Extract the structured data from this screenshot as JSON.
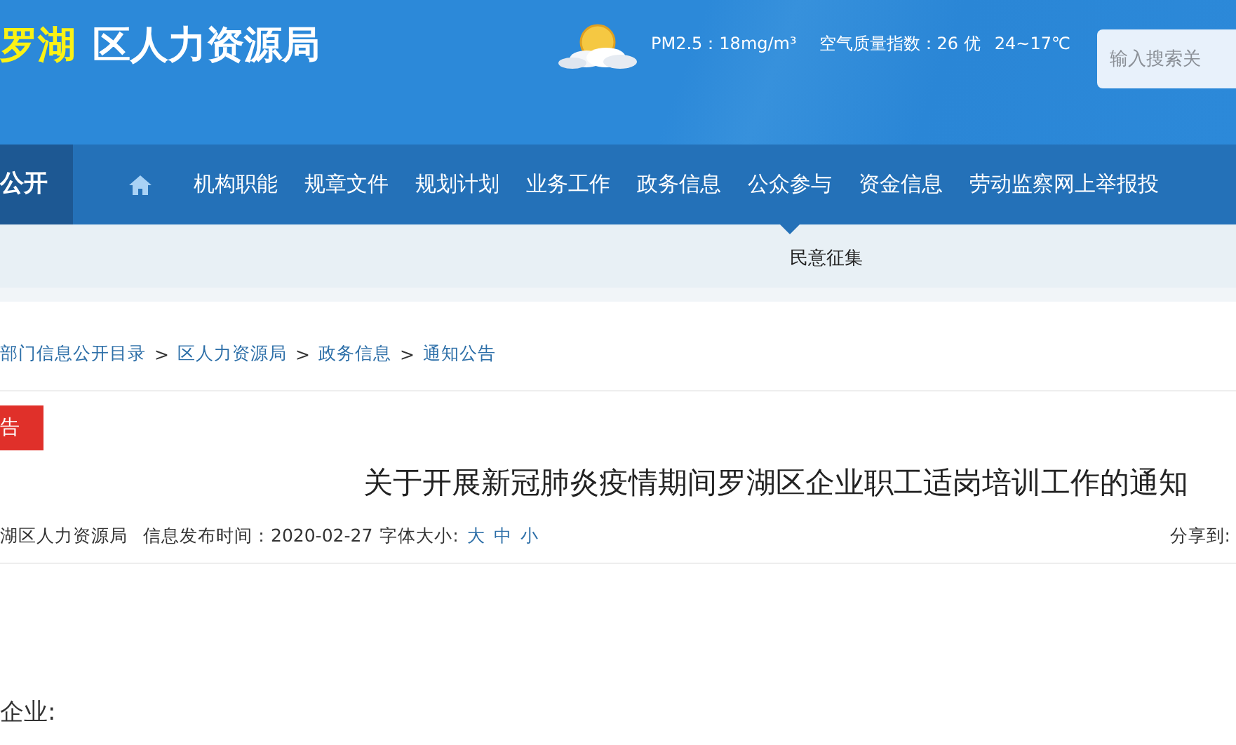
{
  "header": {
    "logo_highlight": "罗湖",
    "logo_text": "区人力资源局",
    "weather": {
      "pm25": "PM2.5：18mg/m³",
      "aqi": "空气质量指数：26 优",
      "temperature": "24~17℃"
    },
    "search": {
      "placeholder": "输入搜索关"
    }
  },
  "nav": {
    "section_label": "公开",
    "items": [
      {
        "label": "机构职能",
        "selected": false
      },
      {
        "label": "规章文件",
        "selected": false
      },
      {
        "label": "规划计划",
        "selected": false
      },
      {
        "label": "业务工作",
        "selected": false
      },
      {
        "label": "政务信息",
        "selected": false
      },
      {
        "label": "公众参与",
        "selected": true
      },
      {
        "label": "资金信息",
        "selected": false
      },
      {
        "label": "劳动监察网上举报投",
        "selected": false
      }
    ]
  },
  "subnav": {
    "items": [
      "民意征集"
    ]
  },
  "breadcrumb": [
    {
      "kind": "link",
      "text": "部门信息公开目录"
    },
    {
      "kind": "separator",
      "text": ">"
    },
    {
      "kind": "link",
      "text": "区人力资源局"
    },
    {
      "kind": "separator",
      "text": ">"
    },
    {
      "kind": "link",
      "text": "政务信息"
    },
    {
      "kind": "separator",
      "text": ">"
    },
    {
      "kind": "link",
      "text": "通知公告"
    }
  ],
  "article": {
    "tag": "告",
    "title": "关于开展新冠肺炎疫情期间罗湖区企业职工适岗培训工作的通知",
    "meta": {
      "source": "湖区人力资源局",
      "published": "信息发布时间：2020-02-27",
      "font_size_label": "字体大小:",
      "font_sizes": [
        "大",
        "中",
        "小"
      ],
      "share_label": "分享到:"
    },
    "body": [
      "企业:"
    ]
  }
}
